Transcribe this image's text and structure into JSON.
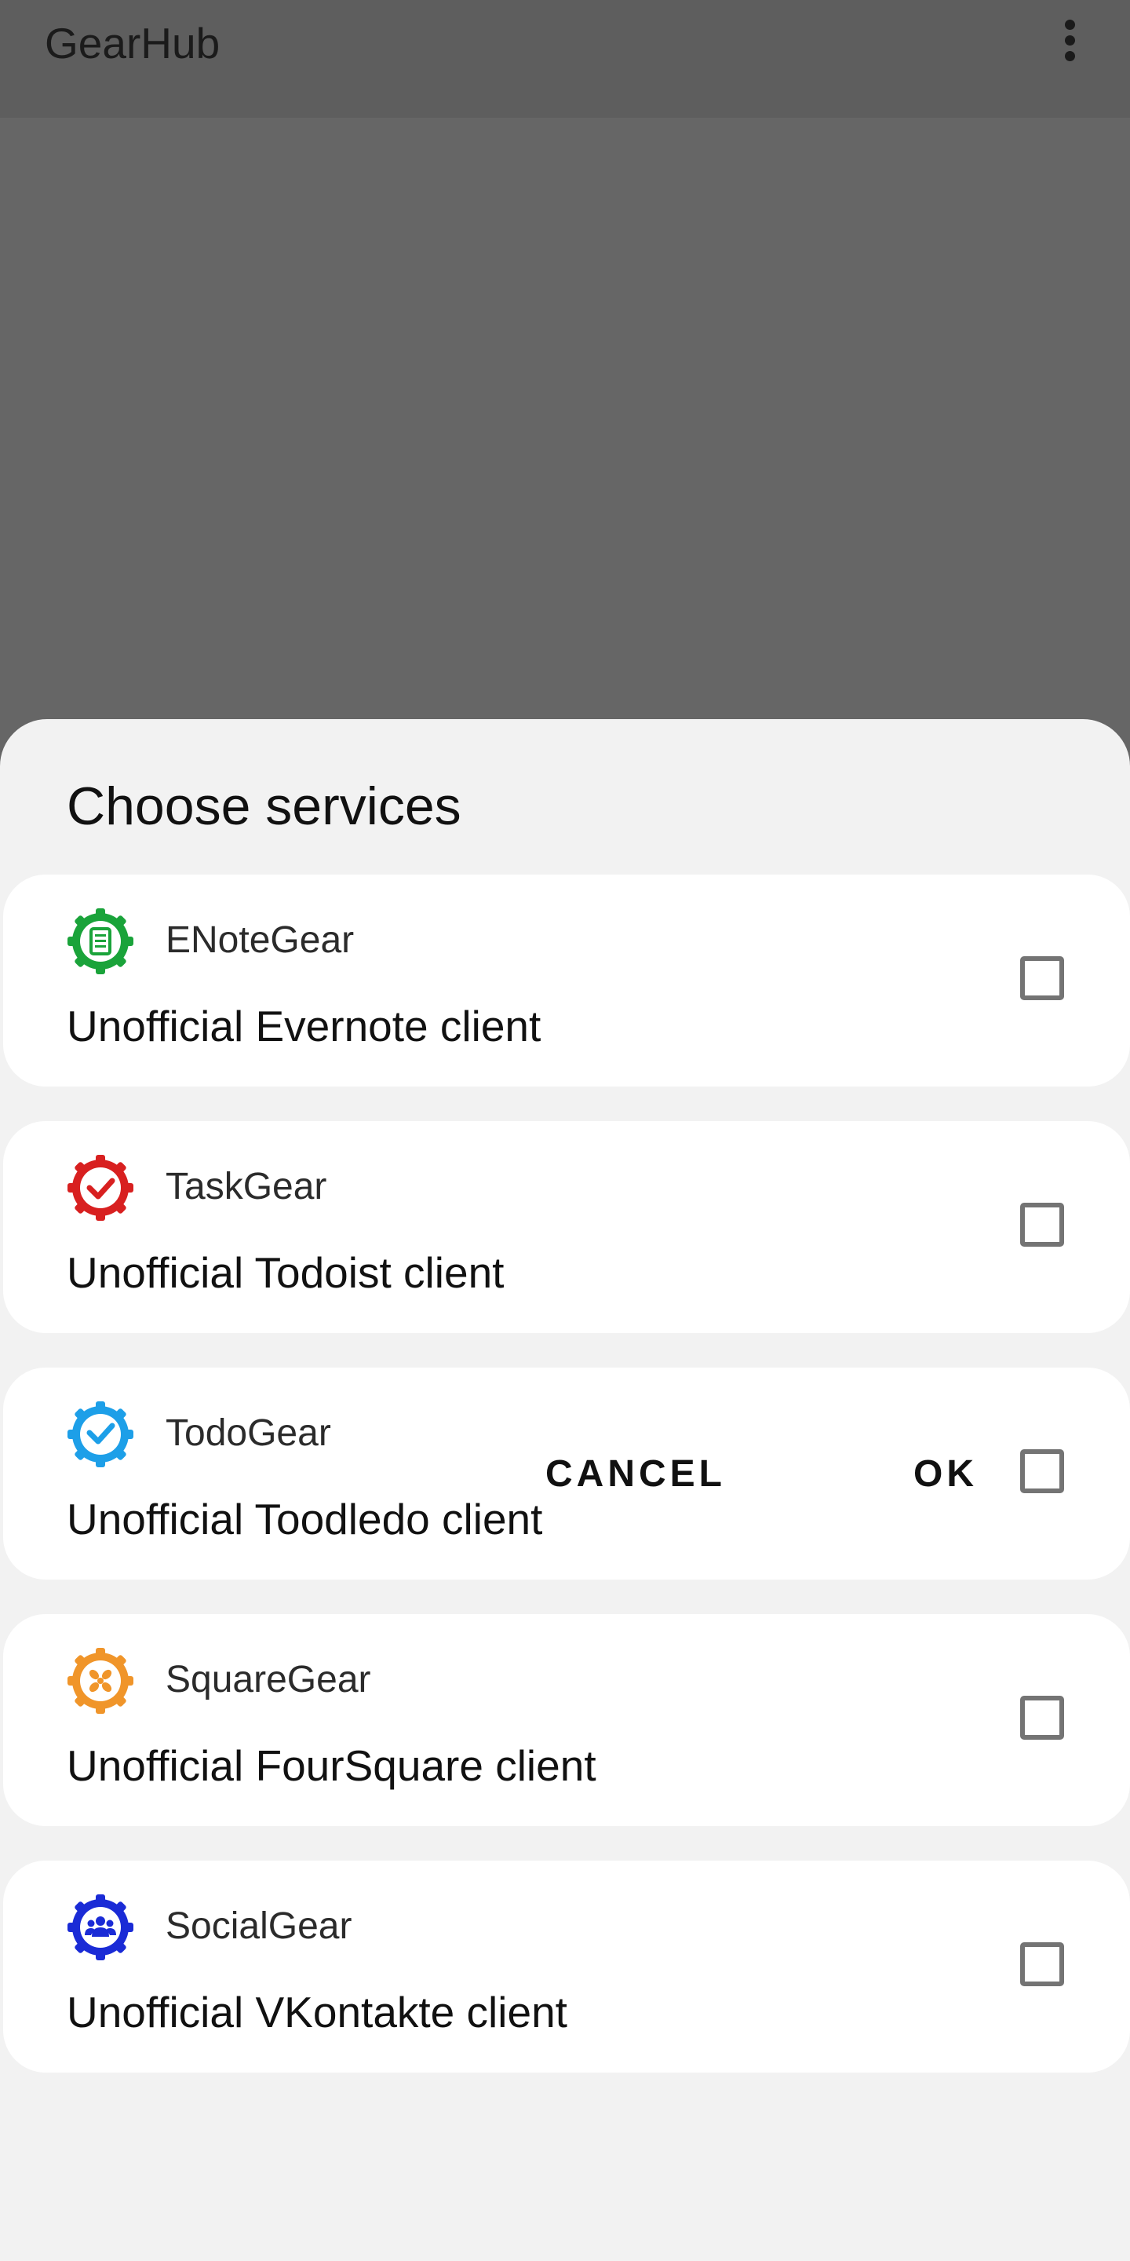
{
  "app": {
    "title": "GearHub"
  },
  "dialog": {
    "title": "Choose services",
    "services": [
      {
        "name": "ENoteGear",
        "description": "Unofficial Evernote client",
        "icon": "enotegear-icon",
        "color": "#1aa33a",
        "checked": false
      },
      {
        "name": "TaskGear",
        "description": "Unofficial Todoist client",
        "icon": "taskgear-icon",
        "color": "#d82020",
        "checked": false
      },
      {
        "name": "TodoGear",
        "description": "Unofficial Toodledo client",
        "icon": "todogear-icon",
        "color": "#1d9fe8",
        "checked": false
      },
      {
        "name": "SquareGear",
        "description": "Unofficial FourSquare client",
        "icon": "squaregear-icon",
        "color": "#f0952a",
        "checked": false
      },
      {
        "name": "SocialGear",
        "description": "Unofficial VKontakte client",
        "icon": "socialgear-icon",
        "color": "#1a2bd6",
        "checked": false
      }
    ],
    "cancel_label": "CANCEL",
    "ok_label": "OK"
  }
}
